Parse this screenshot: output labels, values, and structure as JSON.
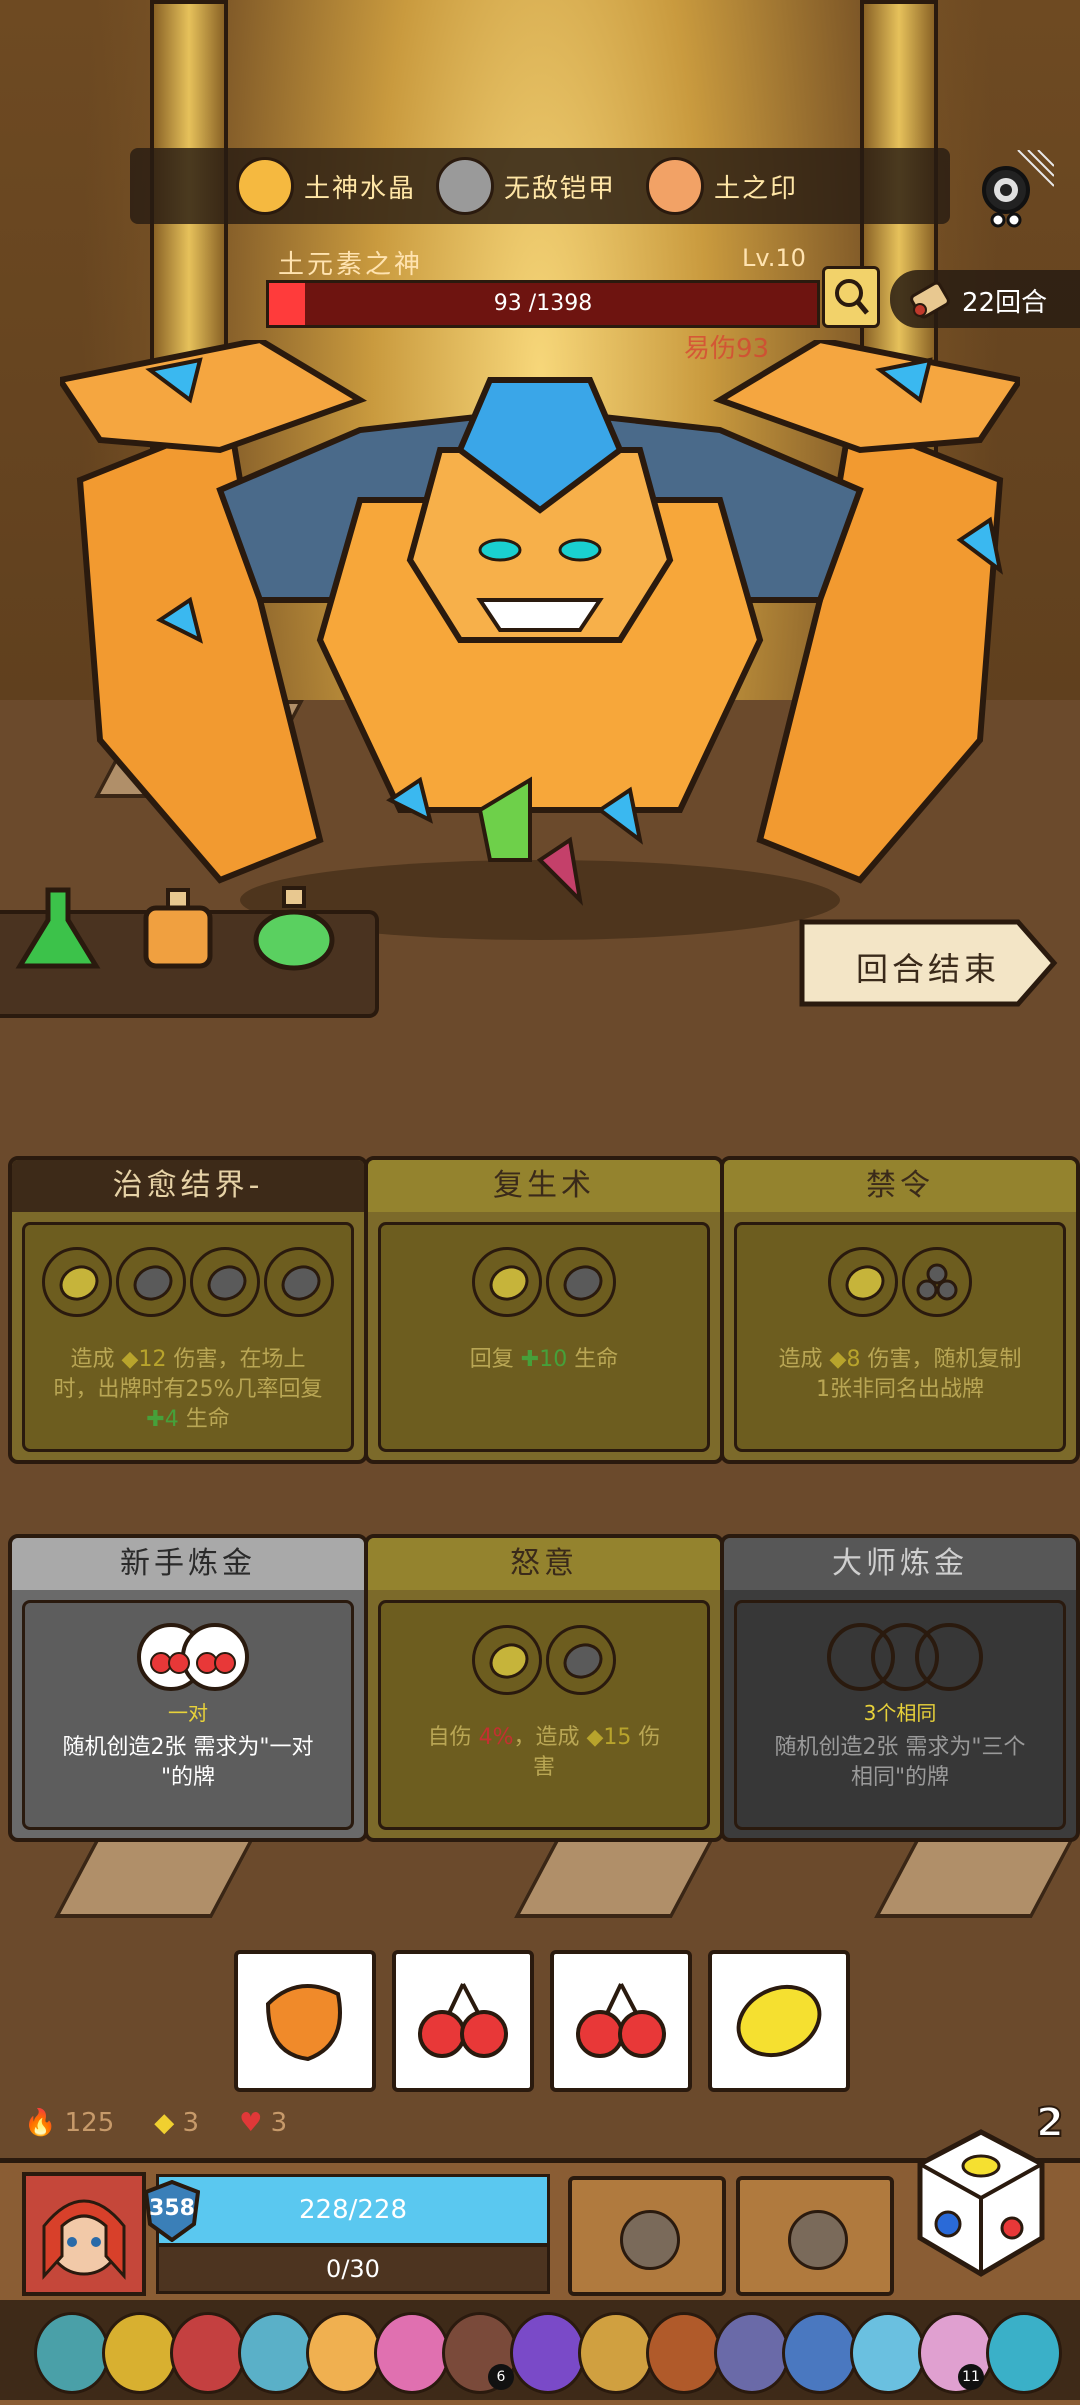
{
  "relics_top": [
    {
      "name": "土神水晶",
      "icon": "crystal-cluster-icon",
      "color": "#f5b940"
    },
    {
      "name": "无敌铠甲",
      "icon": "armor-shell-icon",
      "color": "#9a9a9a"
    },
    {
      "name": "土之印",
      "icon": "earth-seal-icon",
      "color": "#f2a266"
    }
  ],
  "boss": {
    "name": "土元素之神",
    "level": "Lv.10",
    "hp_text": "93 /1398",
    "hp_current": 93,
    "hp_max": 1398,
    "floating_text": "易伤93"
  },
  "turns": "22回合",
  "end_turn_label": "回合结束",
  "potions": [
    {
      "icon": "green-flask-icon",
      "color": "#3cc24a"
    },
    {
      "icon": "orange-bottle-icon",
      "color": "#f0a040"
    },
    {
      "icon": "green-bottle-icon",
      "color": "#5ad060"
    }
  ],
  "cards": [
    {
      "title": "治愈结界-",
      "style": "brown",
      "slots": [
        "lemon",
        "grey",
        "grey",
        "grey"
      ],
      "desc_line1_a": "造成",
      "desc_line1_num": "12",
      "desc_line1_b": "伤害，在场上",
      "desc_line2": "时，出牌时有25%几率回复",
      "desc_line3_num": "4",
      "desc_line3_b": "生命"
    },
    {
      "title": "复生术",
      "style": "gold",
      "slots": [
        "lemon",
        "grey"
      ],
      "desc_a": "回复",
      "desc_num": "10",
      "desc_b": "生命"
    },
    {
      "title": "禁令",
      "style": "gold",
      "slots": [
        "lemon",
        "triple"
      ],
      "desc_line1_a": "造成",
      "desc_line1_num": "8",
      "desc_line1_b": "伤害，随机复制",
      "desc_line2": "1张非同名出战牌"
    },
    {
      "title": "新手炼金",
      "style": "silver",
      "requirement": "一对",
      "desc_line1": "随机创造2张 需求为\"一对",
      "desc_line2": "\"的牌"
    },
    {
      "title": "怒意",
      "style": "gold",
      "slots": [
        "lemon",
        "grey"
      ],
      "desc_line1_a": "自伤",
      "desc_line1_num": "4%",
      "desc_line1_b": "，造成",
      "desc_line1_num2": "15",
      "desc_line1_c": "伤",
      "desc_line2": "害"
    },
    {
      "title": "大师炼金",
      "style": "dark",
      "requirement": "3个相同",
      "desc_line1": "随机创造2张 需求为\"三个",
      "desc_line2": "相同\"的牌"
    }
  ],
  "dice": [
    {
      "icon": "mango-icon",
      "color": "#f08a2a"
    },
    {
      "icon": "cherry-icon",
      "color": "#e83838"
    },
    {
      "icon": "cherry-icon",
      "color": "#e83838"
    },
    {
      "icon": "lemon-icon",
      "color": "#f5e030"
    }
  ],
  "stats": {
    "fire": "125",
    "diamond": "3",
    "heart": "3"
  },
  "dice_count": "2",
  "player": {
    "shield": "358",
    "hp_text": "228/228",
    "xp_text": "0/30"
  },
  "relic_badges": {
    "b1": "6",
    "b2": "11"
  }
}
